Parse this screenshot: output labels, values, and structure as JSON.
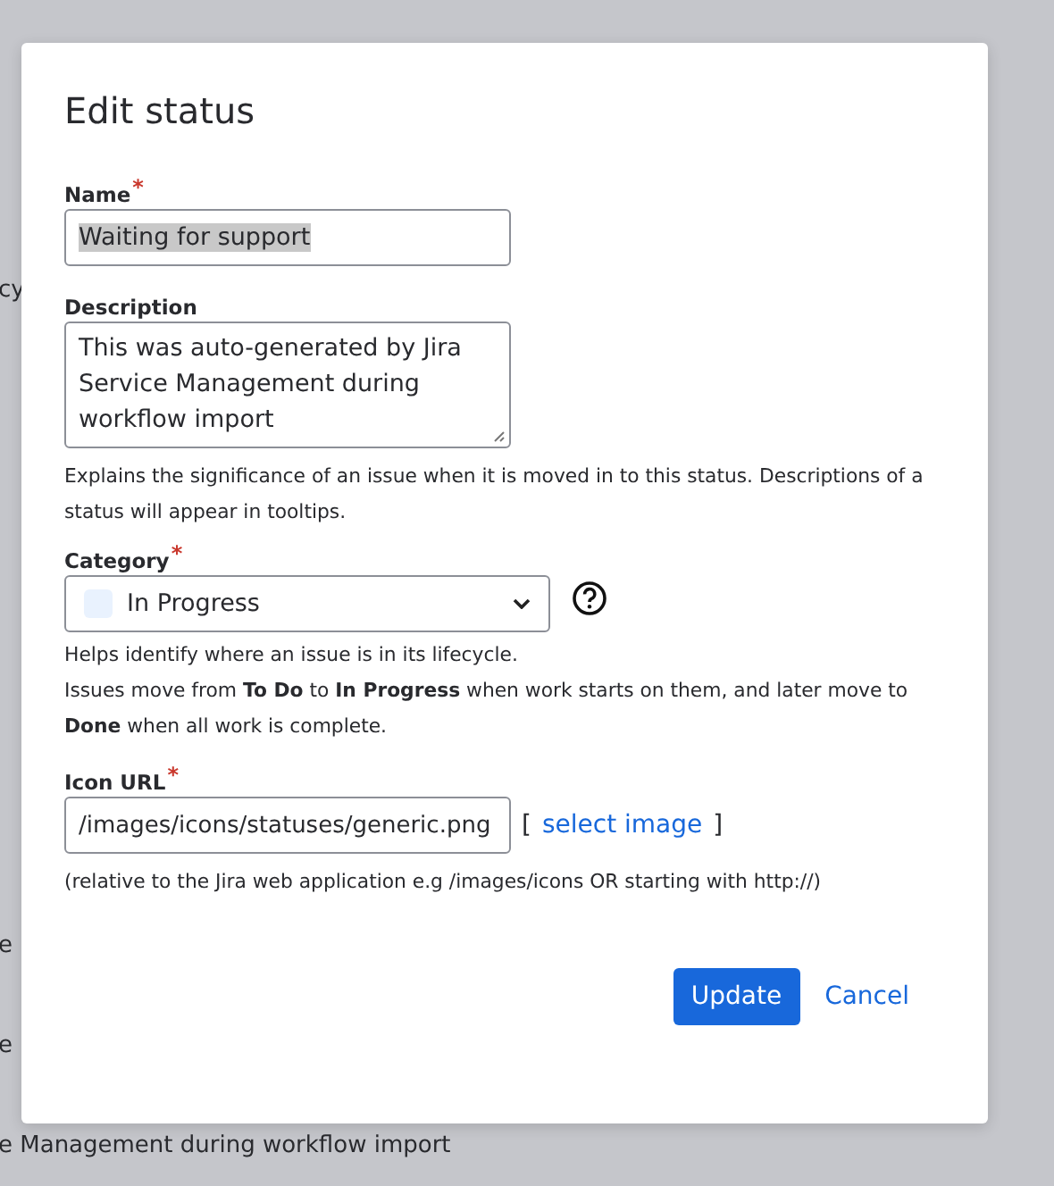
{
  "background": {
    "texts": [
      "cy",
      "e",
      "e",
      "e Management during workflow import"
    ]
  },
  "dialog": {
    "title": "Edit status",
    "name": {
      "label": "Name",
      "required": true,
      "required_mark": "*",
      "value": "Waiting for support",
      "value_selected": true
    },
    "description": {
      "label": "Description",
      "required": false,
      "value": "This was auto-generated by Jira Service Management during workflow import",
      "help": "Explains the significance of an issue when it is moved in to this status. Descriptions of a status will appear in tooltips."
    },
    "category": {
      "label": "Category",
      "required": true,
      "required_mark": "*",
      "value": "In Progress",
      "color": "#e9f2fe",
      "help": [
        "Helps identify where an issue is in its lifecycle.",
        "Issues move from **To Do** to **In Progress** when work starts on them, and later move to **Done** when all work is complete."
      ]
    },
    "icon_url": {
      "label": "Icon URL",
      "required": true,
      "required_mark": "*",
      "value": "/images/icons/statuses/generic.png",
      "bracket_open": "[",
      "link": "select image",
      "bracket_close": "]",
      "help": "(relative to the Jira web application e.g /images/icons OR starting with http://)"
    },
    "buttons": [
      {
        "label": "Update",
        "kind": "primary"
      },
      {
        "label": "Cancel",
        "kind": "link"
      }
    ]
  }
}
